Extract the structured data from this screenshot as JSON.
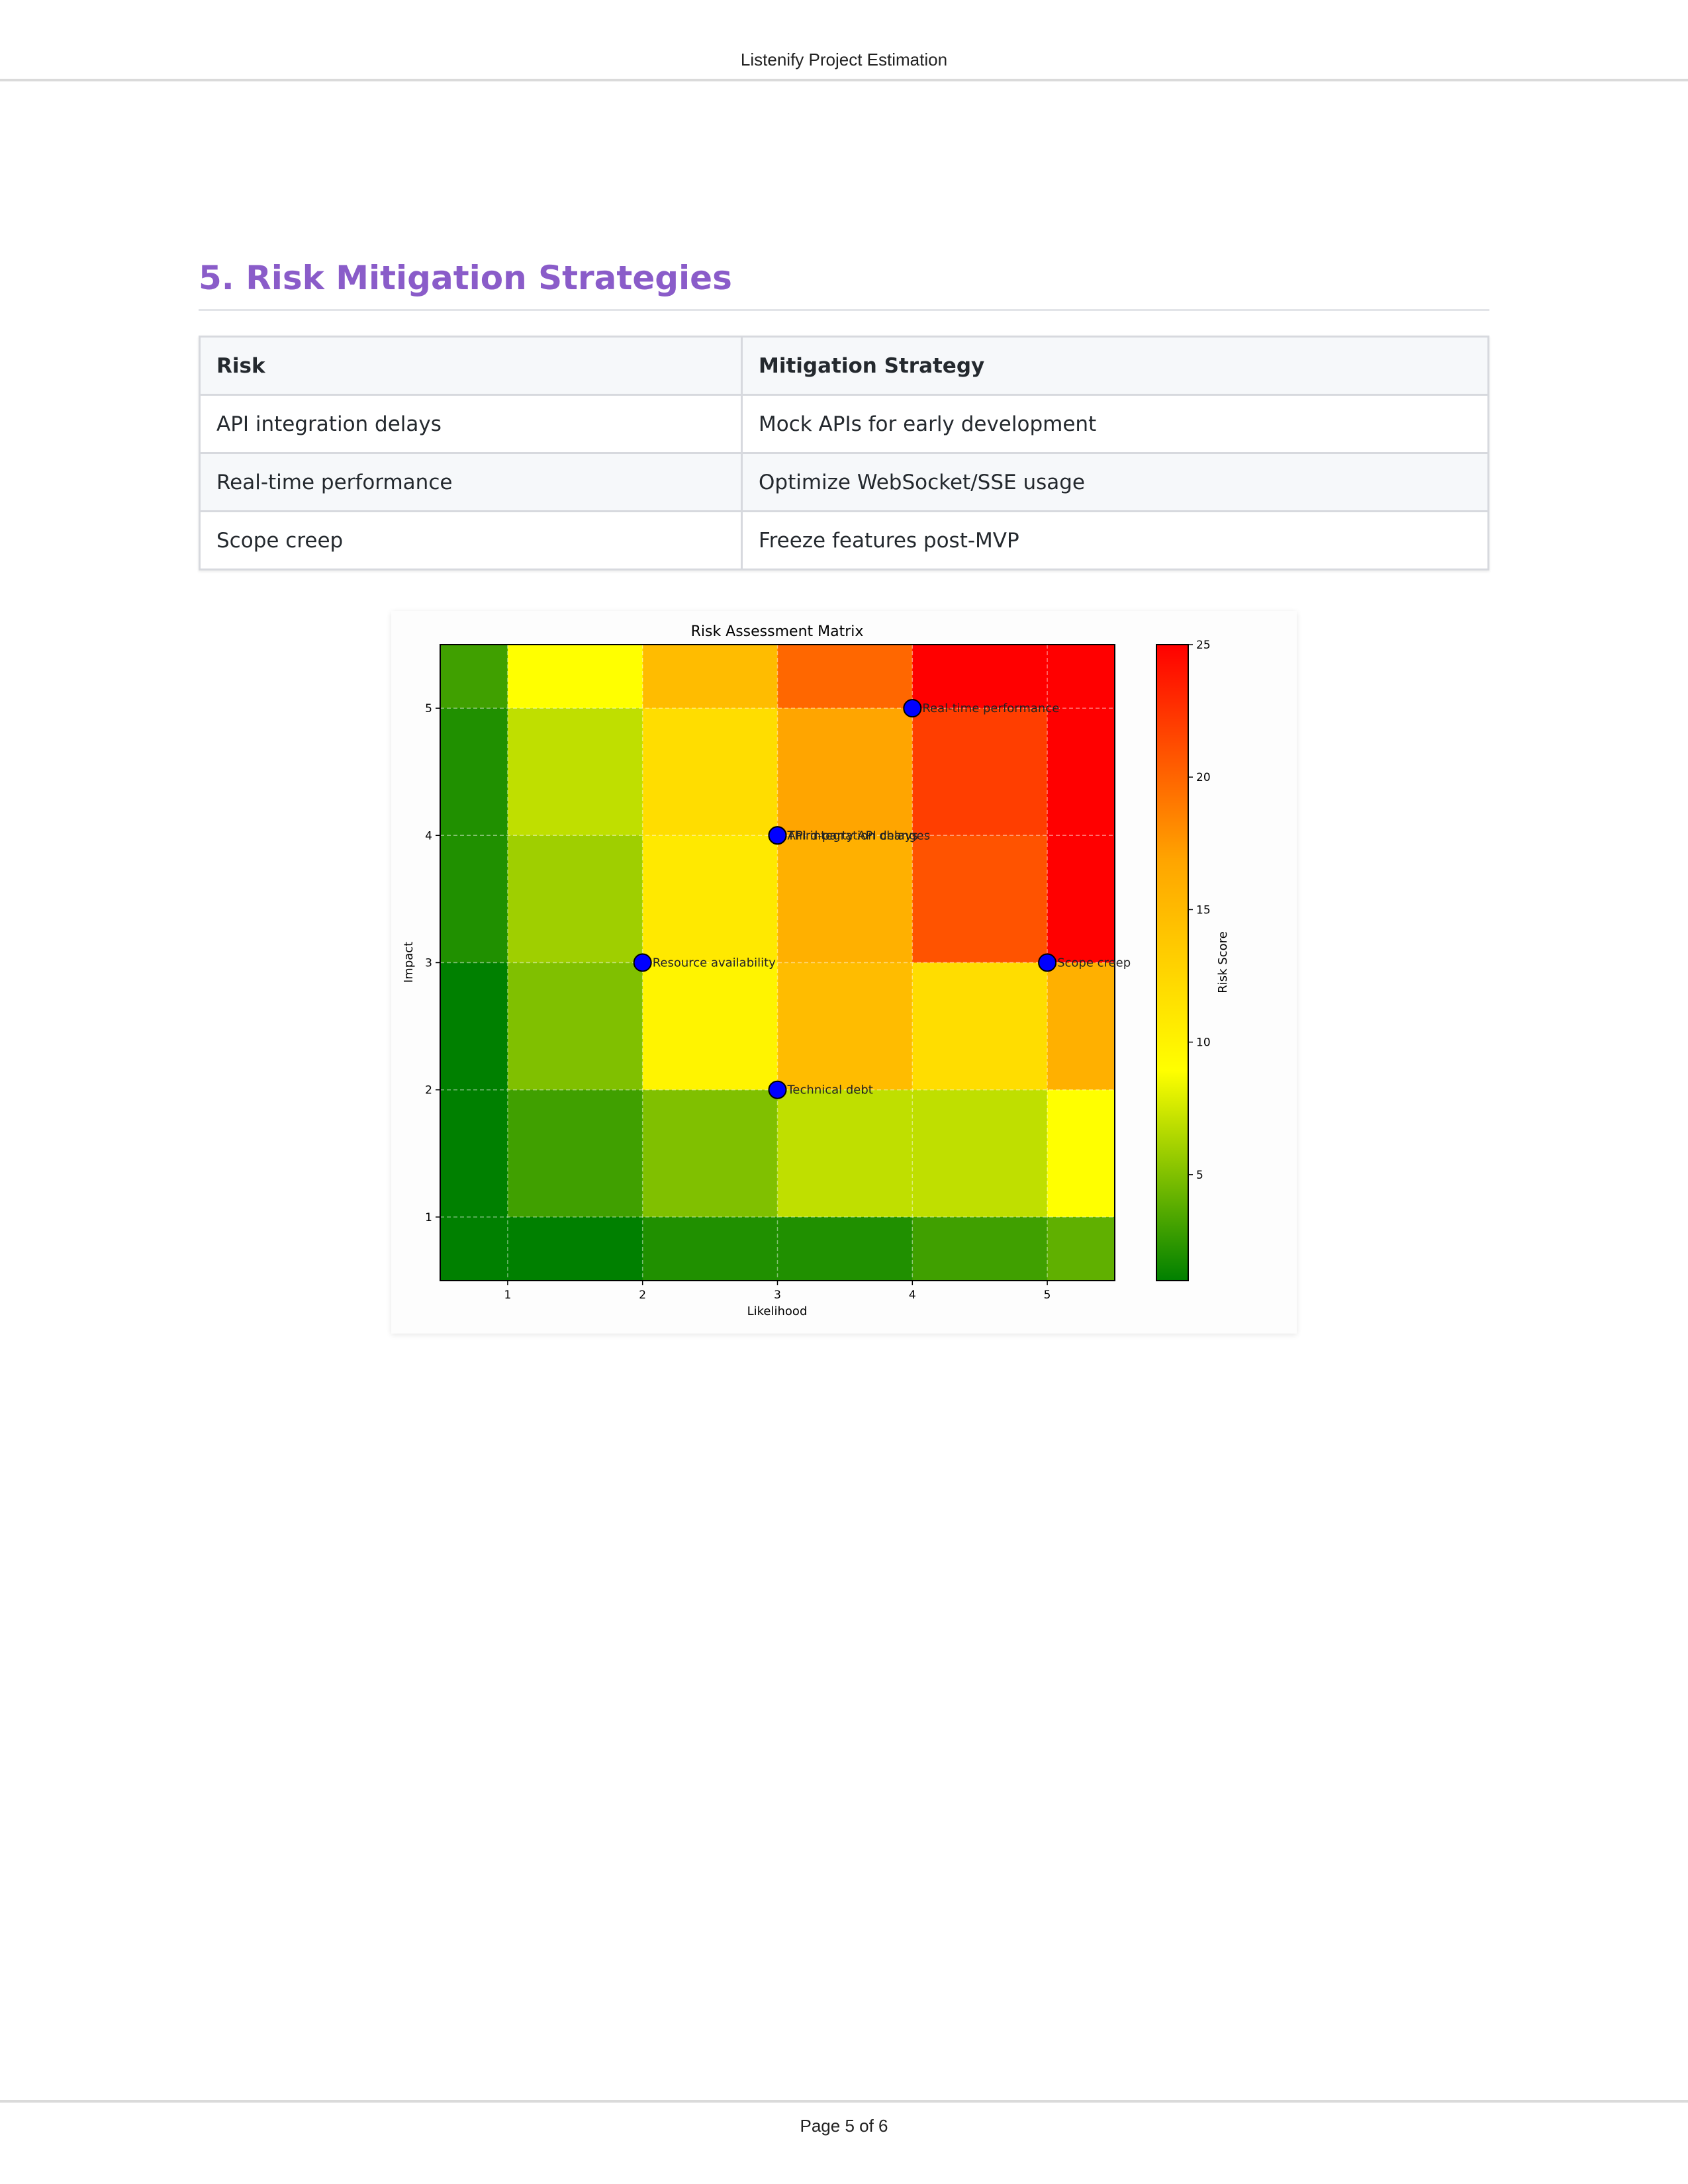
{
  "header": {
    "title": "Listenify Project Estimation"
  },
  "section": {
    "title": "5. Risk Mitigation Strategies"
  },
  "table": {
    "headers": [
      "Risk",
      "Mitigation Strategy"
    ],
    "rows": [
      [
        "API integration delays",
        "Mock APIs for early development"
      ],
      [
        "Real-time performance",
        "Optimize WebSocket/SSE usage"
      ],
      [
        "Scope creep",
        "Freeze features post-MVP"
      ]
    ]
  },
  "chart_data": {
    "type": "heatmap",
    "title": "Risk Assessment Matrix",
    "xlabel": "Likelihood",
    "ylabel": "Impact",
    "colorbar_label": "Risk Score",
    "xlim": [
      0.5,
      5.5
    ],
    "ylim": [
      0.5,
      5.5
    ],
    "x_ticks": [
      1,
      2,
      3,
      4,
      5
    ],
    "y_ticks": [
      1,
      2,
      3,
      4,
      5
    ],
    "colorbar_range": [
      1,
      25
    ],
    "colorbar_ticks": [
      5,
      10,
      15,
      20,
      25
    ],
    "colormap": [
      "#008000",
      "#ffff00",
      "#ffa500",
      "#ff0000"
    ],
    "grid": true,
    "heatmap_columns": [
      0.5,
      1,
      2,
      3,
      4,
      5,
      5.5
    ],
    "heatmap_rows": [
      5.5,
      5,
      4,
      3,
      2,
      1,
      0.5
    ],
    "heatmap_values": [
      [
        3,
        9,
        15,
        20,
        25,
        25
      ],
      [
        2,
        7,
        12,
        17,
        22,
        25
      ],
      [
        2,
        6,
        11,
        16,
        21,
        25
      ],
      [
        1,
        5,
        10,
        15,
        12,
        16
      ],
      [
        1,
        3,
        5,
        7,
        7,
        9
      ],
      [
        1,
        1,
        2,
        2,
        3,
        4
      ]
    ],
    "points": [
      {
        "x": 4,
        "y": 5,
        "label": "Real-time performance"
      },
      {
        "x": 3,
        "y": 4,
        "label": "API integration delays"
      },
      {
        "x": 3,
        "y": 4,
        "label": "Third-party API changes"
      },
      {
        "x": 2,
        "y": 3,
        "label": "Resource availability"
      },
      {
        "x": 5,
        "y": 3,
        "label": "Scope creep"
      },
      {
        "x": 3,
        "y": 2,
        "label": "Technical debt"
      }
    ],
    "point_color": "#0000ff"
  },
  "footer": {
    "page_label": "Page 5 of 6"
  }
}
